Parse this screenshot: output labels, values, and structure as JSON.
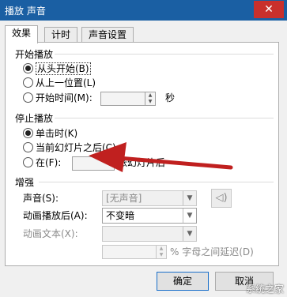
{
  "window": {
    "title": "播放 声音",
    "close_glyph": "✕"
  },
  "tabs": [
    {
      "label": "效果",
      "active": true
    },
    {
      "label": "计时",
      "active": false
    },
    {
      "label": "声音设置",
      "active": false
    }
  ],
  "start_playback": {
    "title": "开始播放",
    "option_from_start": "从头开始(B)",
    "option_from_last": "从上一位置(L)",
    "option_start_time": "开始时间(M):",
    "seconds_unit": "秒",
    "selected": "from_start"
  },
  "stop_playback": {
    "title": "停止播放",
    "option_on_click": "单击时(K)",
    "option_after_current": "当前幻灯片之后(C)",
    "option_after_n": "在(F):",
    "after_n_suffix": "张幻灯片后",
    "selected": "on_click"
  },
  "enhance": {
    "title": "增强",
    "sound_label": "声音(S):",
    "sound_value": "[无声音]",
    "after_animation_label": "动画播放后(A):",
    "after_animation_value": "不变暗",
    "animate_text_label": "动画文本(X):",
    "animate_text_value": "",
    "delay_unit": "% 字母之间延迟(D)"
  },
  "buttons": {
    "ok": "确定",
    "cancel": "取消"
  },
  "watermark": "系统之家",
  "colors": {
    "title_bar": "#1a5fa3",
    "close_button": "#c9302c",
    "arrow": "#c0201f"
  },
  "icons": {
    "speaker": "speaker-icon",
    "spin_up": "▲",
    "spin_down": "▼",
    "dropdown": "▼"
  }
}
